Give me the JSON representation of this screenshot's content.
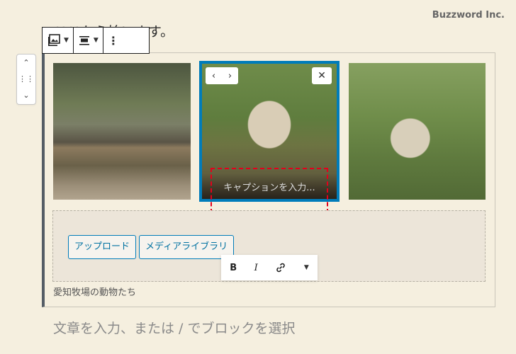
{
  "watermark": "Buzzword Inc.",
  "top_paragraph": "ここから始います。",
  "toolbar": {
    "change_type_icon": "gallery-icon",
    "align_icon": "align-center-icon",
    "more_icon": "more-vertical-icon"
  },
  "images": [
    {
      "name": "goats-on-log"
    },
    {
      "name": "sheep-standing",
      "selected": true
    },
    {
      "name": "sheep-grazing"
    }
  ],
  "image_caption_placeholder": "キャプションを入力...",
  "buttons": {
    "upload": "アップロード",
    "media_library": "メディアライブラリ"
  },
  "format_toolbar": {
    "bold": "B",
    "italic": "I",
    "link_icon": "link-icon",
    "more_icon": "chevron-down-icon"
  },
  "gallery_caption": "愛知牧場の動物たち",
  "next_paragraph_placeholder": "文章を入力、または / でブロックを選択",
  "colors": {
    "accent": "#007cba",
    "highlight": "#e4001b",
    "background": "#f5efdf"
  }
}
